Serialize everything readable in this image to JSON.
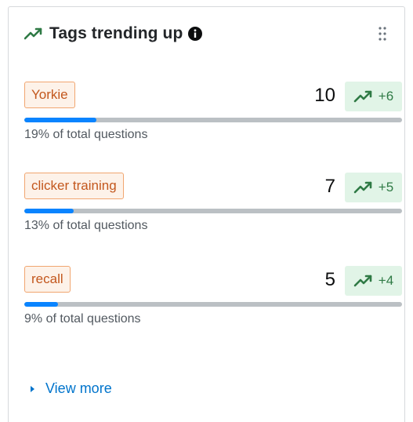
{
  "widget": {
    "title": "Tags trending up",
    "title_icon": "trending-up-icon",
    "info_icon": "info-icon",
    "menu_icon": "drag-handle-icon"
  },
  "tags": [
    {
      "name": "Yorkie",
      "count": "10",
      "delta": "+6",
      "share_text": "19% of total questions",
      "share": 0.19
    },
    {
      "name": "clicker training",
      "count": "7",
      "delta": "+5",
      "share_text": "13% of total questions",
      "share": 0.13
    },
    {
      "name": "recall",
      "count": "5",
      "delta": "+4",
      "share_text": "9% of total questions",
      "share": 0.09
    }
  ],
  "footer": {
    "view_more_label": "View more"
  },
  "colors": {
    "accent_blue": "#0a84ff",
    "trend_green": "#2f7a45",
    "trend_bg": "#e1f4e7",
    "tag_orange": "#c3571d",
    "tag_bg": "#fdf2e9"
  }
}
